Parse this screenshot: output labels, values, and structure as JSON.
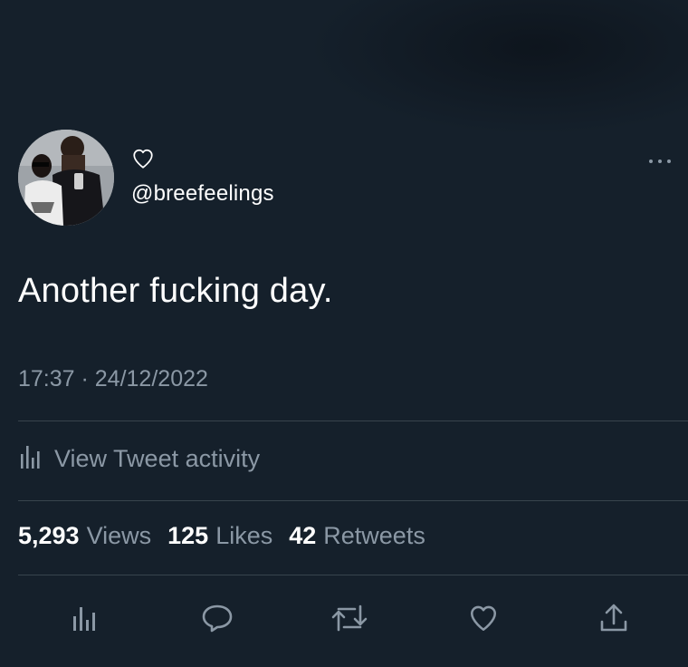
{
  "author": {
    "handle": "@breefeelings",
    "avatar_icon": "profile-photo"
  },
  "tweet": {
    "text": "Another fucking day.",
    "timestamp": "17:37 · 24/12/2022"
  },
  "activity": {
    "label": "View Tweet activity",
    "icon": "analytics-icon"
  },
  "stats": {
    "views_count": "5,293",
    "views_label": "Views",
    "likes_count": "125",
    "likes_label": "Likes",
    "retweets_count": "42",
    "retweets_label": "Retweets"
  },
  "actions": [
    "analytics-icon",
    "reply-icon",
    "retweet-icon",
    "like-icon",
    "share-icon"
  ],
  "colors": {
    "background": "#15202b",
    "text": "#ffffff",
    "secondary": "#8b98a5",
    "accent": "#1d9bf0",
    "divider": "#38444d"
  }
}
